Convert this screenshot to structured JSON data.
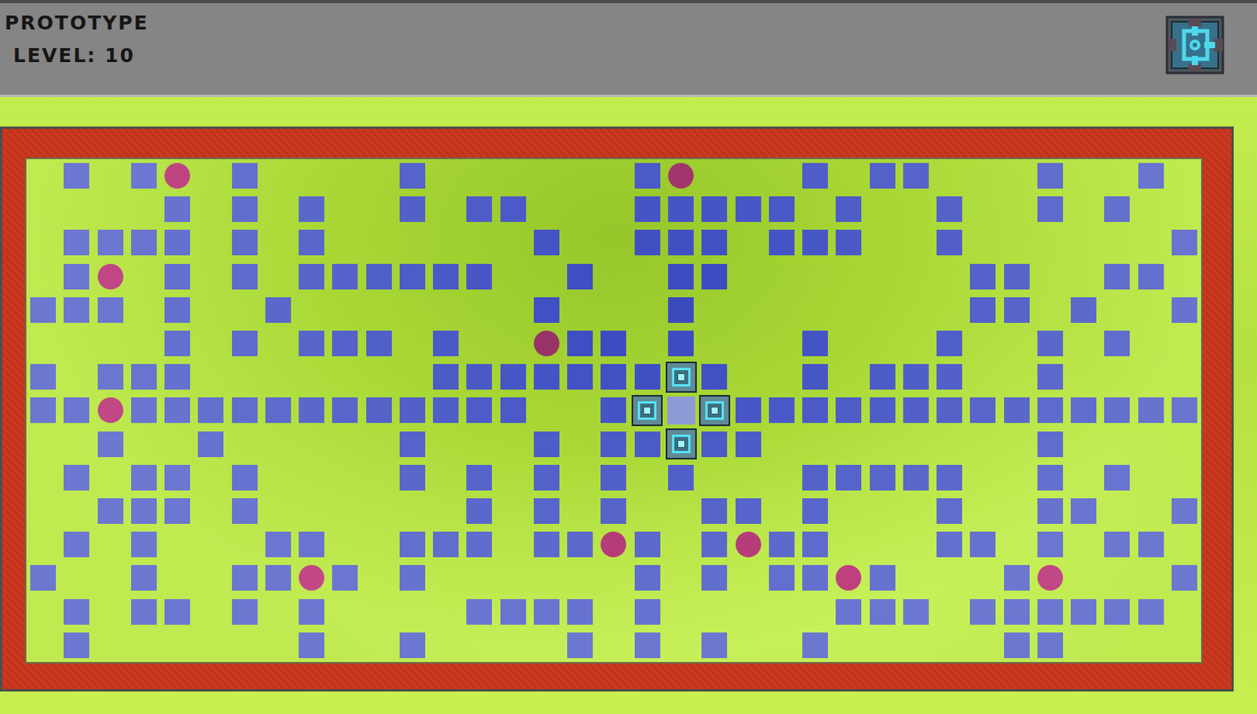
{
  "header": {
    "title": "PROTOTYPE",
    "level_label": "LEVEL: 10"
  },
  "board": {
    "rows": [
      [
        "none",
        "wall",
        "none",
        "wall",
        "orb",
        "none",
        "wall",
        "none",
        "none",
        "none",
        "none",
        "wall",
        "none",
        "none",
        "none",
        "none",
        "none",
        "none",
        "wall",
        "orb",
        "none",
        "none",
        "none",
        "wall",
        "none",
        "wall",
        "wall",
        "none",
        "none",
        "none",
        "wall",
        "none",
        "none",
        "wall",
        "none"
      ],
      [
        "none",
        "none",
        "none",
        "none",
        "wall",
        "none",
        "wall",
        "none",
        "wall",
        "none",
        "none",
        "wall",
        "none",
        "wall",
        "wall",
        "none",
        "none",
        "none",
        "wall",
        "wall",
        "wall",
        "wall",
        "wall",
        "none",
        "wall",
        "none",
        "none",
        "wall",
        "none",
        "none",
        "wall",
        "none",
        "wall",
        "none",
        "none"
      ],
      [
        "none",
        "wall",
        "wall",
        "wall",
        "wall",
        "none",
        "wall",
        "none",
        "wall",
        "none",
        "none",
        "none",
        "none",
        "none",
        "none",
        "wall",
        "none",
        "none",
        "wall",
        "wall",
        "wall",
        "none",
        "wall",
        "wall",
        "wall",
        "none",
        "none",
        "wall",
        "none",
        "none",
        "none",
        "none",
        "none",
        "none",
        "wall"
      ],
      [
        "none",
        "wall",
        "orb",
        "none",
        "wall",
        "none",
        "wall",
        "none",
        "wall",
        "wall",
        "wall",
        "wall",
        "wall",
        "wall",
        "none",
        "none",
        "wall",
        "none",
        "none",
        "wall",
        "wall",
        "none",
        "none",
        "none",
        "none",
        "none",
        "none",
        "none",
        "wall",
        "wall",
        "none",
        "none",
        "wall",
        "wall",
        "none"
      ],
      [
        "wall",
        "wall",
        "wall",
        "none",
        "wall",
        "none",
        "none",
        "wall",
        "none",
        "none",
        "none",
        "none",
        "none",
        "none",
        "none",
        "wall",
        "none",
        "none",
        "none",
        "wall",
        "none",
        "none",
        "none",
        "none",
        "none",
        "none",
        "none",
        "none",
        "wall",
        "wall",
        "none",
        "wall",
        "none",
        "none",
        "wall"
      ],
      [
        "none",
        "none",
        "none",
        "none",
        "wall",
        "none",
        "wall",
        "none",
        "wall",
        "wall",
        "wall",
        "none",
        "wall",
        "none",
        "none",
        "orb",
        "wall",
        "wall",
        "none",
        "wall",
        "none",
        "none",
        "none",
        "wall",
        "none",
        "none",
        "none",
        "wall",
        "none",
        "none",
        "wall",
        "none",
        "wall",
        "none",
        "none"
      ],
      [
        "wall",
        "none",
        "wall",
        "wall",
        "wall",
        "none",
        "none",
        "none",
        "none",
        "none",
        "none",
        "none",
        "wall",
        "wall",
        "wall",
        "wall",
        "wall",
        "wall",
        "wall",
        "bot",
        "wall",
        "none",
        "none",
        "wall",
        "none",
        "wall",
        "wall",
        "wall",
        "none",
        "none",
        "wall",
        "none",
        "none",
        "none",
        "none"
      ],
      [
        "wall",
        "wall",
        "orb",
        "wall",
        "wall",
        "wall",
        "wall",
        "wall",
        "wall",
        "wall",
        "wall",
        "wall",
        "wall",
        "wall",
        "wall",
        "none",
        "none",
        "wall",
        "bot",
        "hub",
        "bot",
        "wall",
        "wall",
        "wall",
        "wall",
        "wall",
        "wall",
        "wall",
        "wall",
        "wall",
        "wall",
        "wall",
        "wall",
        "wall",
        "wall"
      ],
      [
        "none",
        "none",
        "wall",
        "none",
        "none",
        "wall",
        "none",
        "none",
        "none",
        "none",
        "none",
        "wall",
        "none",
        "none",
        "none",
        "wall",
        "none",
        "wall",
        "wall",
        "bot",
        "wall",
        "wall",
        "none",
        "none",
        "none",
        "none",
        "none",
        "none",
        "none",
        "none",
        "wall",
        "none",
        "none",
        "none",
        "none"
      ],
      [
        "none",
        "wall",
        "none",
        "wall",
        "wall",
        "none",
        "wall",
        "none",
        "none",
        "none",
        "none",
        "wall",
        "none",
        "wall",
        "none",
        "wall",
        "none",
        "wall",
        "none",
        "wall",
        "none",
        "none",
        "none",
        "wall",
        "wall",
        "wall",
        "wall",
        "wall",
        "none",
        "none",
        "wall",
        "none",
        "wall",
        "none",
        "none"
      ],
      [
        "none",
        "none",
        "wall",
        "wall",
        "wall",
        "none",
        "wall",
        "none",
        "none",
        "none",
        "none",
        "none",
        "none",
        "wall",
        "none",
        "wall",
        "none",
        "wall",
        "none",
        "none",
        "wall",
        "wall",
        "none",
        "wall",
        "none",
        "none",
        "none",
        "wall",
        "none",
        "none",
        "wall",
        "wall",
        "none",
        "none",
        "wall"
      ],
      [
        "none",
        "wall",
        "none",
        "wall",
        "none",
        "none",
        "none",
        "wall",
        "wall",
        "none",
        "none",
        "wall",
        "wall",
        "wall",
        "none",
        "wall",
        "wall",
        "orb",
        "wall",
        "none",
        "wall",
        "orb",
        "wall",
        "wall",
        "none",
        "none",
        "none",
        "wall",
        "wall",
        "none",
        "wall",
        "none",
        "wall",
        "wall",
        "none"
      ],
      [
        "wall",
        "none",
        "none",
        "wall",
        "none",
        "none",
        "wall",
        "wall",
        "orb",
        "wall",
        "none",
        "wall",
        "none",
        "none",
        "none",
        "none",
        "none",
        "none",
        "wall",
        "none",
        "wall",
        "none",
        "wall",
        "wall",
        "orb",
        "wall",
        "none",
        "none",
        "none",
        "wall",
        "orb",
        "none",
        "none",
        "none",
        "wall"
      ],
      [
        "none",
        "wall",
        "none",
        "wall",
        "wall",
        "none",
        "wall",
        "none",
        "wall",
        "none",
        "none",
        "none",
        "none",
        "wall",
        "wall",
        "wall",
        "wall",
        "none",
        "wall",
        "none",
        "none",
        "none",
        "none",
        "none",
        "wall",
        "wall",
        "wall",
        "none",
        "wall",
        "wall",
        "wall",
        "wall",
        "wall",
        "wall",
        "none"
      ],
      [
        "none",
        "wall",
        "none",
        "none",
        "none",
        "none",
        "none",
        "none",
        "wall",
        "none",
        "none",
        "wall",
        "none",
        "none",
        "none",
        "none",
        "wall",
        "none",
        "wall",
        "none",
        "wall",
        "none",
        "none",
        "wall",
        "none",
        "none",
        "none",
        "none",
        "none",
        "wall",
        "wall",
        "none",
        "none",
        "none",
        "none"
      ]
    ]
  }
}
